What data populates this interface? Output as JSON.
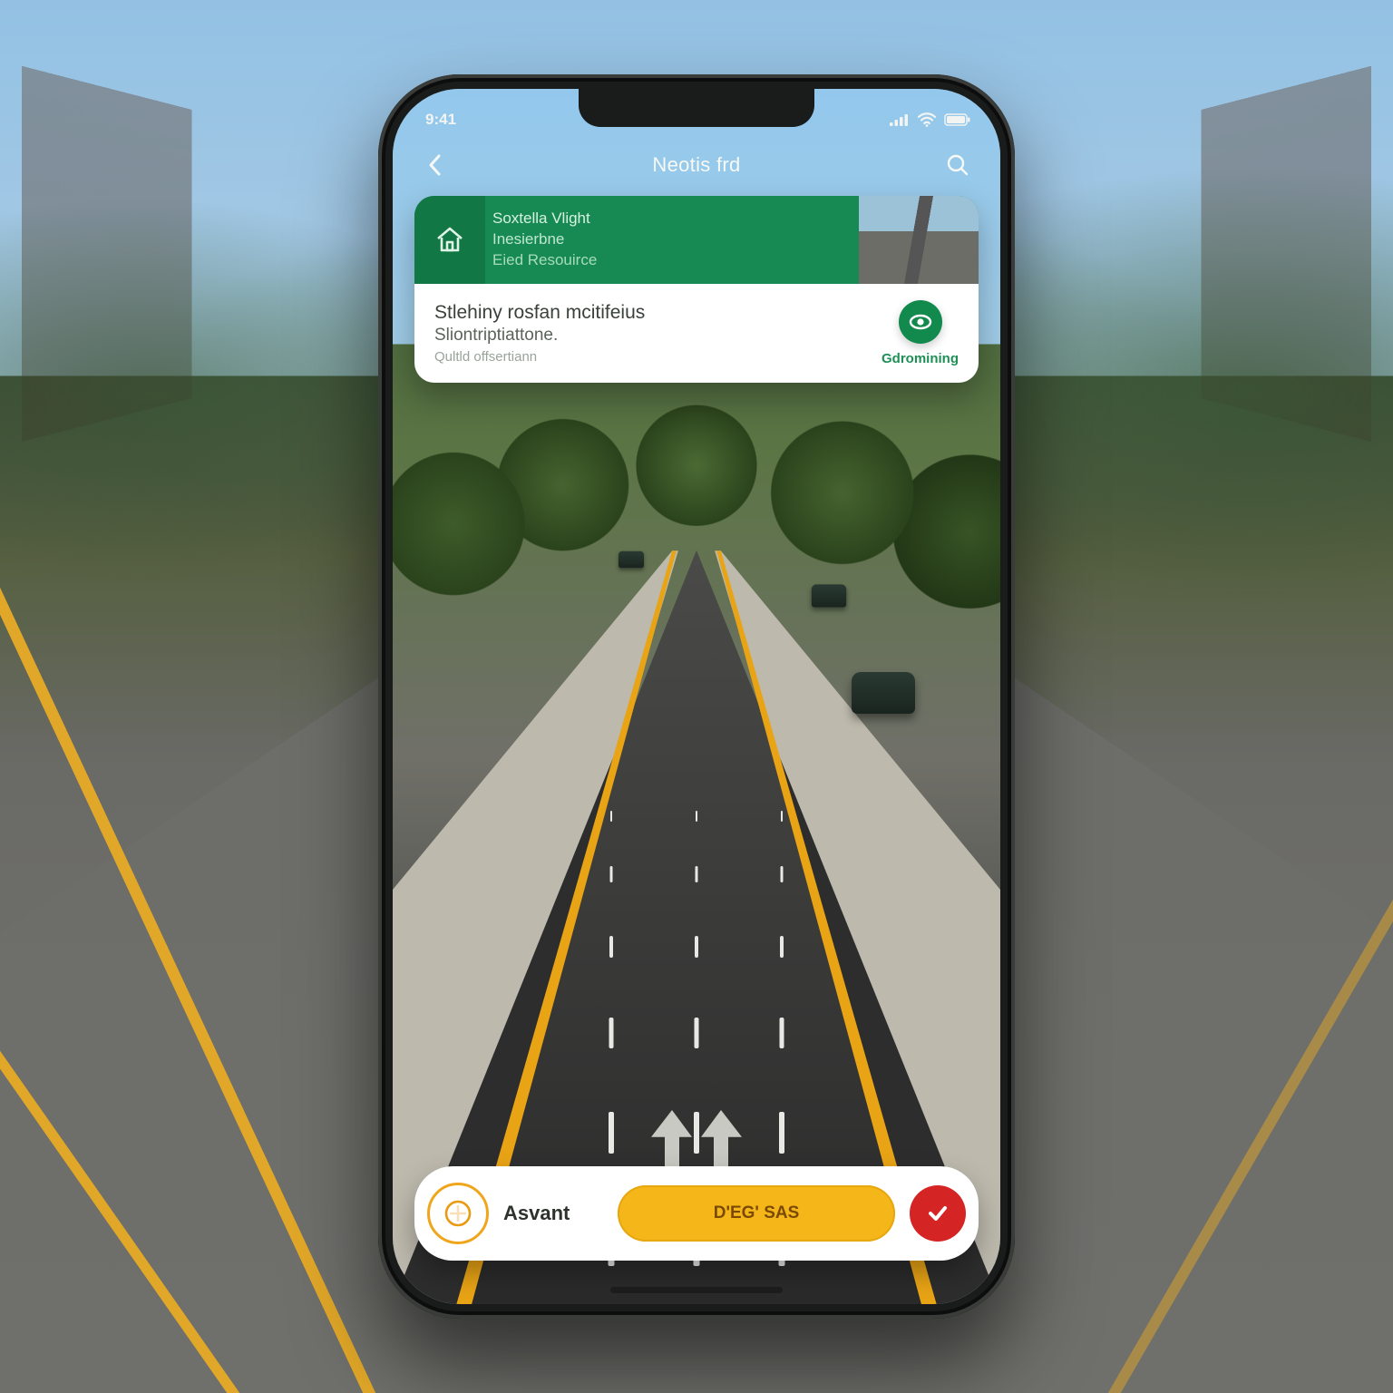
{
  "status": {
    "time": "9:41"
  },
  "header": {
    "title": "Neotis frd"
  },
  "banner": {
    "line_a": "Soxtella Vlight",
    "line_b": "Inesierbne",
    "line_c": "Eied Resouirce",
    "body_line1": "Stlehiny rosfan mcitifeius",
    "body_line2": "Sliontriptiattone.",
    "body_line3": "Qultld offsertiann",
    "action_label": "Gdromining"
  },
  "bottom": {
    "assistant_label": "Asvant",
    "pill_label": "D'EG' SAS"
  },
  "colors": {
    "accent_green": "#178a53",
    "accent_yellow": "#f5b619",
    "accent_red": "#d42424"
  }
}
